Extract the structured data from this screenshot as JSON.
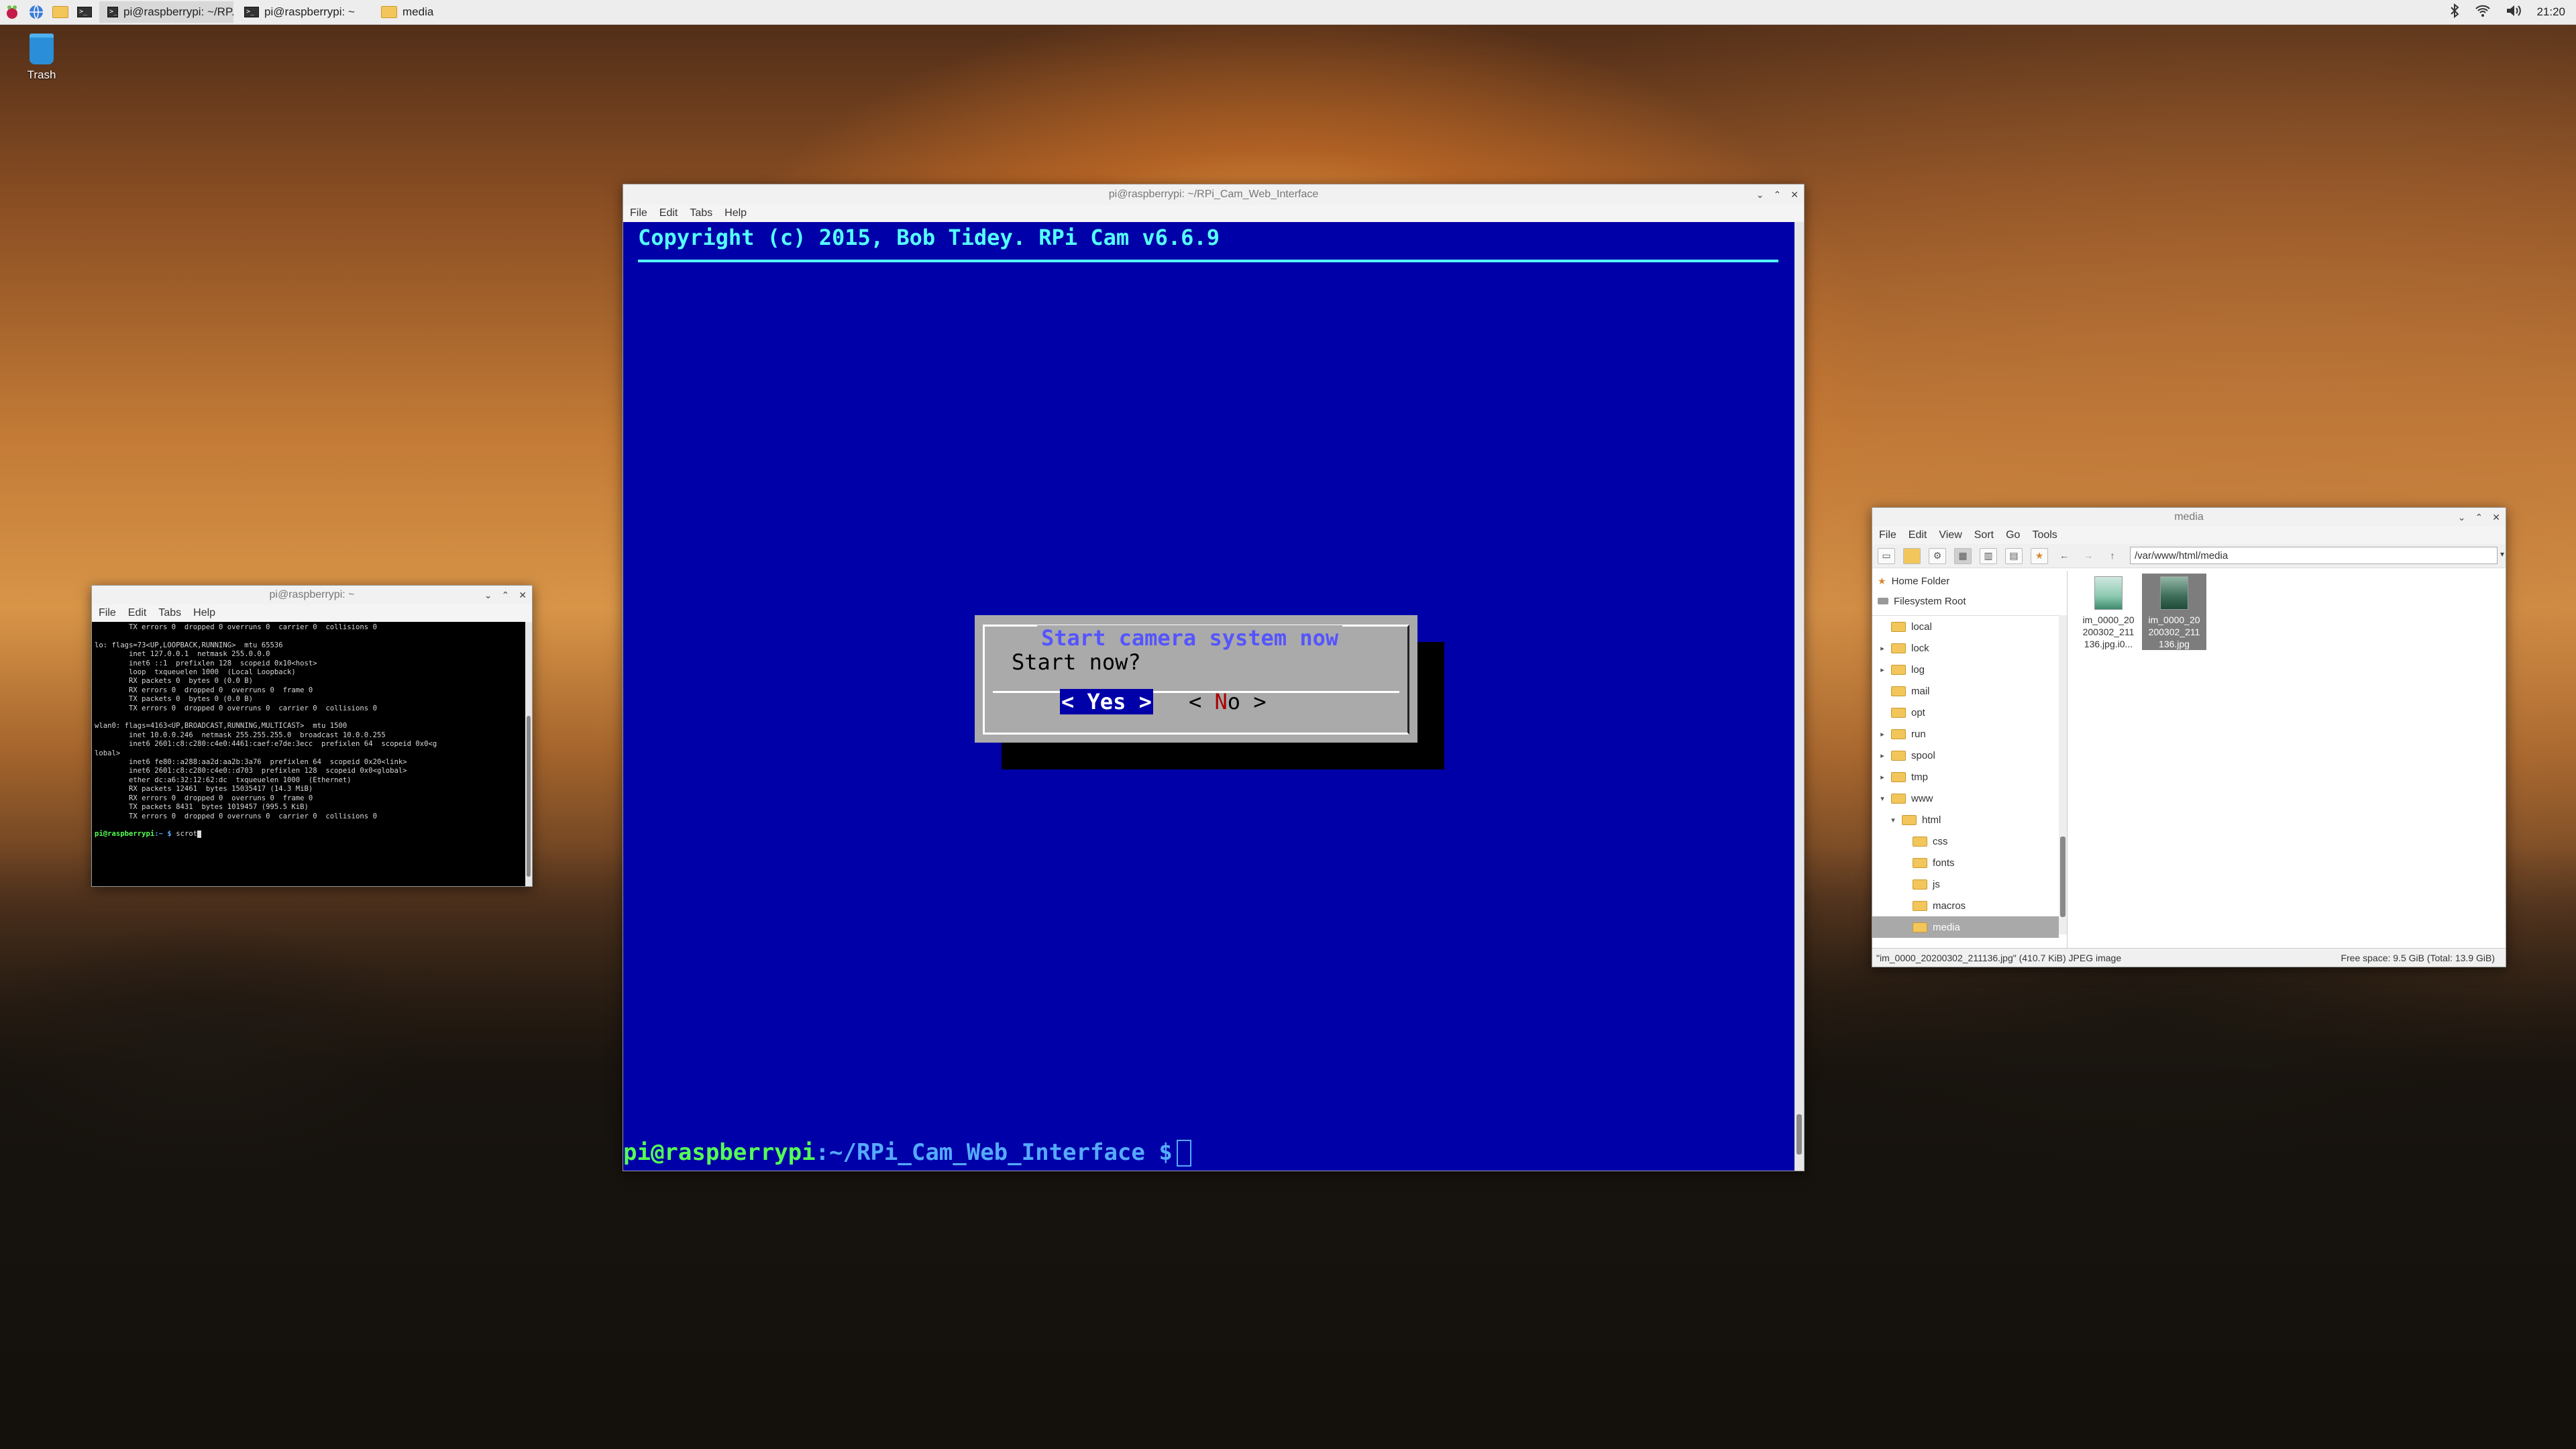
{
  "taskbar": {
    "tasks": [
      {
        "label": "pi@raspberrypi: ~/RP...",
        "icon": "terminal-icon"
      },
      {
        "label": "pi@raspberrypi: ~",
        "icon": "terminal-icon"
      },
      {
        "label": "media",
        "icon": "folder-icon"
      }
    ],
    "clock": "21:20"
  },
  "desktop": {
    "trash_label": "Trash"
  },
  "main_terminal": {
    "title": "pi@raspberrypi: ~/RPi_Cam_Web_Interface",
    "menu": [
      "File",
      "Edit",
      "Tabs",
      "Help"
    ],
    "copyright": "Copyright (c) 2015, Bob Tidey. RPi Cam v6.6.9",
    "dialog": {
      "title": "Start camera system now",
      "message": "Start now?",
      "yes": "< Yes >",
      "no_left": "< ",
      "no_hot": "N",
      "no_rest": "o  >"
    },
    "prompt_user": "pi@raspberrypi",
    "prompt_path": ":~/RPi_Cam_Web_Interface $"
  },
  "small_terminal": {
    "title": "pi@raspberrypi: ~",
    "menu": [
      "File",
      "Edit",
      "Tabs",
      "Help"
    ],
    "lines": [
      "        TX errors 0  dropped 0 overruns 0  carrier 0  collisions 0",
      "",
      "lo: flags=73<UP,LOOPBACK,RUNNING>  mtu 65536",
      "        inet 127.0.0.1  netmask 255.0.0.0",
      "        inet6 ::1  prefixlen 128  scopeid 0x10<host>",
      "        loop  txqueuelen 1000  (Local Loopback)",
      "        RX packets 0  bytes 0 (0.0 B)",
      "        RX errors 0  dropped 0  overruns 0  frame 0",
      "        TX packets 0  bytes 0 (0.0 B)",
      "        TX errors 0  dropped 0 overruns 0  carrier 0  collisions 0",
      "",
      "wlan0: flags=4163<UP,BROADCAST,RUNNING,MULTICAST>  mtu 1500",
      "        inet 10.0.0.246  netmask 255.255.255.0  broadcast 10.0.0.255",
      "        inet6 2601:c8:c280:c4e0:4461:caef:e7de:3ecc  prefixlen 64  scopeid 0x0<g",
      "lobal>",
      "        inet6 fe80::a288:aa2d:aa2b:3a76  prefixlen 64  scopeid 0x20<link>",
      "        inet6 2601:c8:c280:c4e0::d703  prefixlen 128  scopeid 0x0<global>",
      "        ether dc:a6:32:12:62:dc  txqueuelen 1000  (Ethernet)",
      "        RX packets 12461  bytes 15035417 (14.3 MiB)",
      "        RX errors 0  dropped 0  overruns 0  frame 0",
      "        TX packets 8431  bytes 1019457 (995.5 KiB)",
      "        TX errors 0  dropped 0 overruns 0  carrier 0  collisions 0",
      ""
    ],
    "prompt_user": "pi@raspberrypi",
    "prompt_path": ":~ $",
    "command": " scrot"
  },
  "file_manager": {
    "title": "media",
    "menu": [
      "File",
      "Edit",
      "View",
      "Sort",
      "Go",
      "Tools"
    ],
    "address": "/var/www/html/media",
    "places": [
      "Home Folder",
      "Filesystem Root"
    ],
    "tree": [
      {
        "label": "local",
        "indent": 0,
        "expander": ""
      },
      {
        "label": "lock",
        "indent": 0,
        "expander": "▸"
      },
      {
        "label": "log",
        "indent": 0,
        "expander": "▸"
      },
      {
        "label": "mail",
        "indent": 0,
        "expander": ""
      },
      {
        "label": "opt",
        "indent": 0,
        "expander": ""
      },
      {
        "label": "run",
        "indent": 0,
        "expander": "▸"
      },
      {
        "label": "spool",
        "indent": 0,
        "expander": "▸"
      },
      {
        "label": "tmp",
        "indent": 0,
        "expander": "▸"
      },
      {
        "label": "www",
        "indent": 0,
        "expander": "▾"
      },
      {
        "label": "html",
        "indent": 1,
        "expander": "▾"
      },
      {
        "label": "css",
        "indent": 2,
        "expander": ""
      },
      {
        "label": "fonts",
        "indent": 2,
        "expander": ""
      },
      {
        "label": "js",
        "indent": 2,
        "expander": ""
      },
      {
        "label": "macros",
        "indent": 2,
        "expander": ""
      },
      {
        "label": "media",
        "indent": 2,
        "expander": "",
        "selected": true
      }
    ],
    "files": [
      {
        "name": "im_0000_20\n200302_211\n136.jpg.i0...",
        "selected": false
      },
      {
        "name": "im_0000_20\n200302_211\n136.jpg",
        "selected": true
      }
    ],
    "status_left": "\"im_0000_20200302_211136.jpg\" (410.7 KiB) JPEG image",
    "status_right": "Free space: 9.5 GiB (Total: 13.9 GiB)"
  }
}
